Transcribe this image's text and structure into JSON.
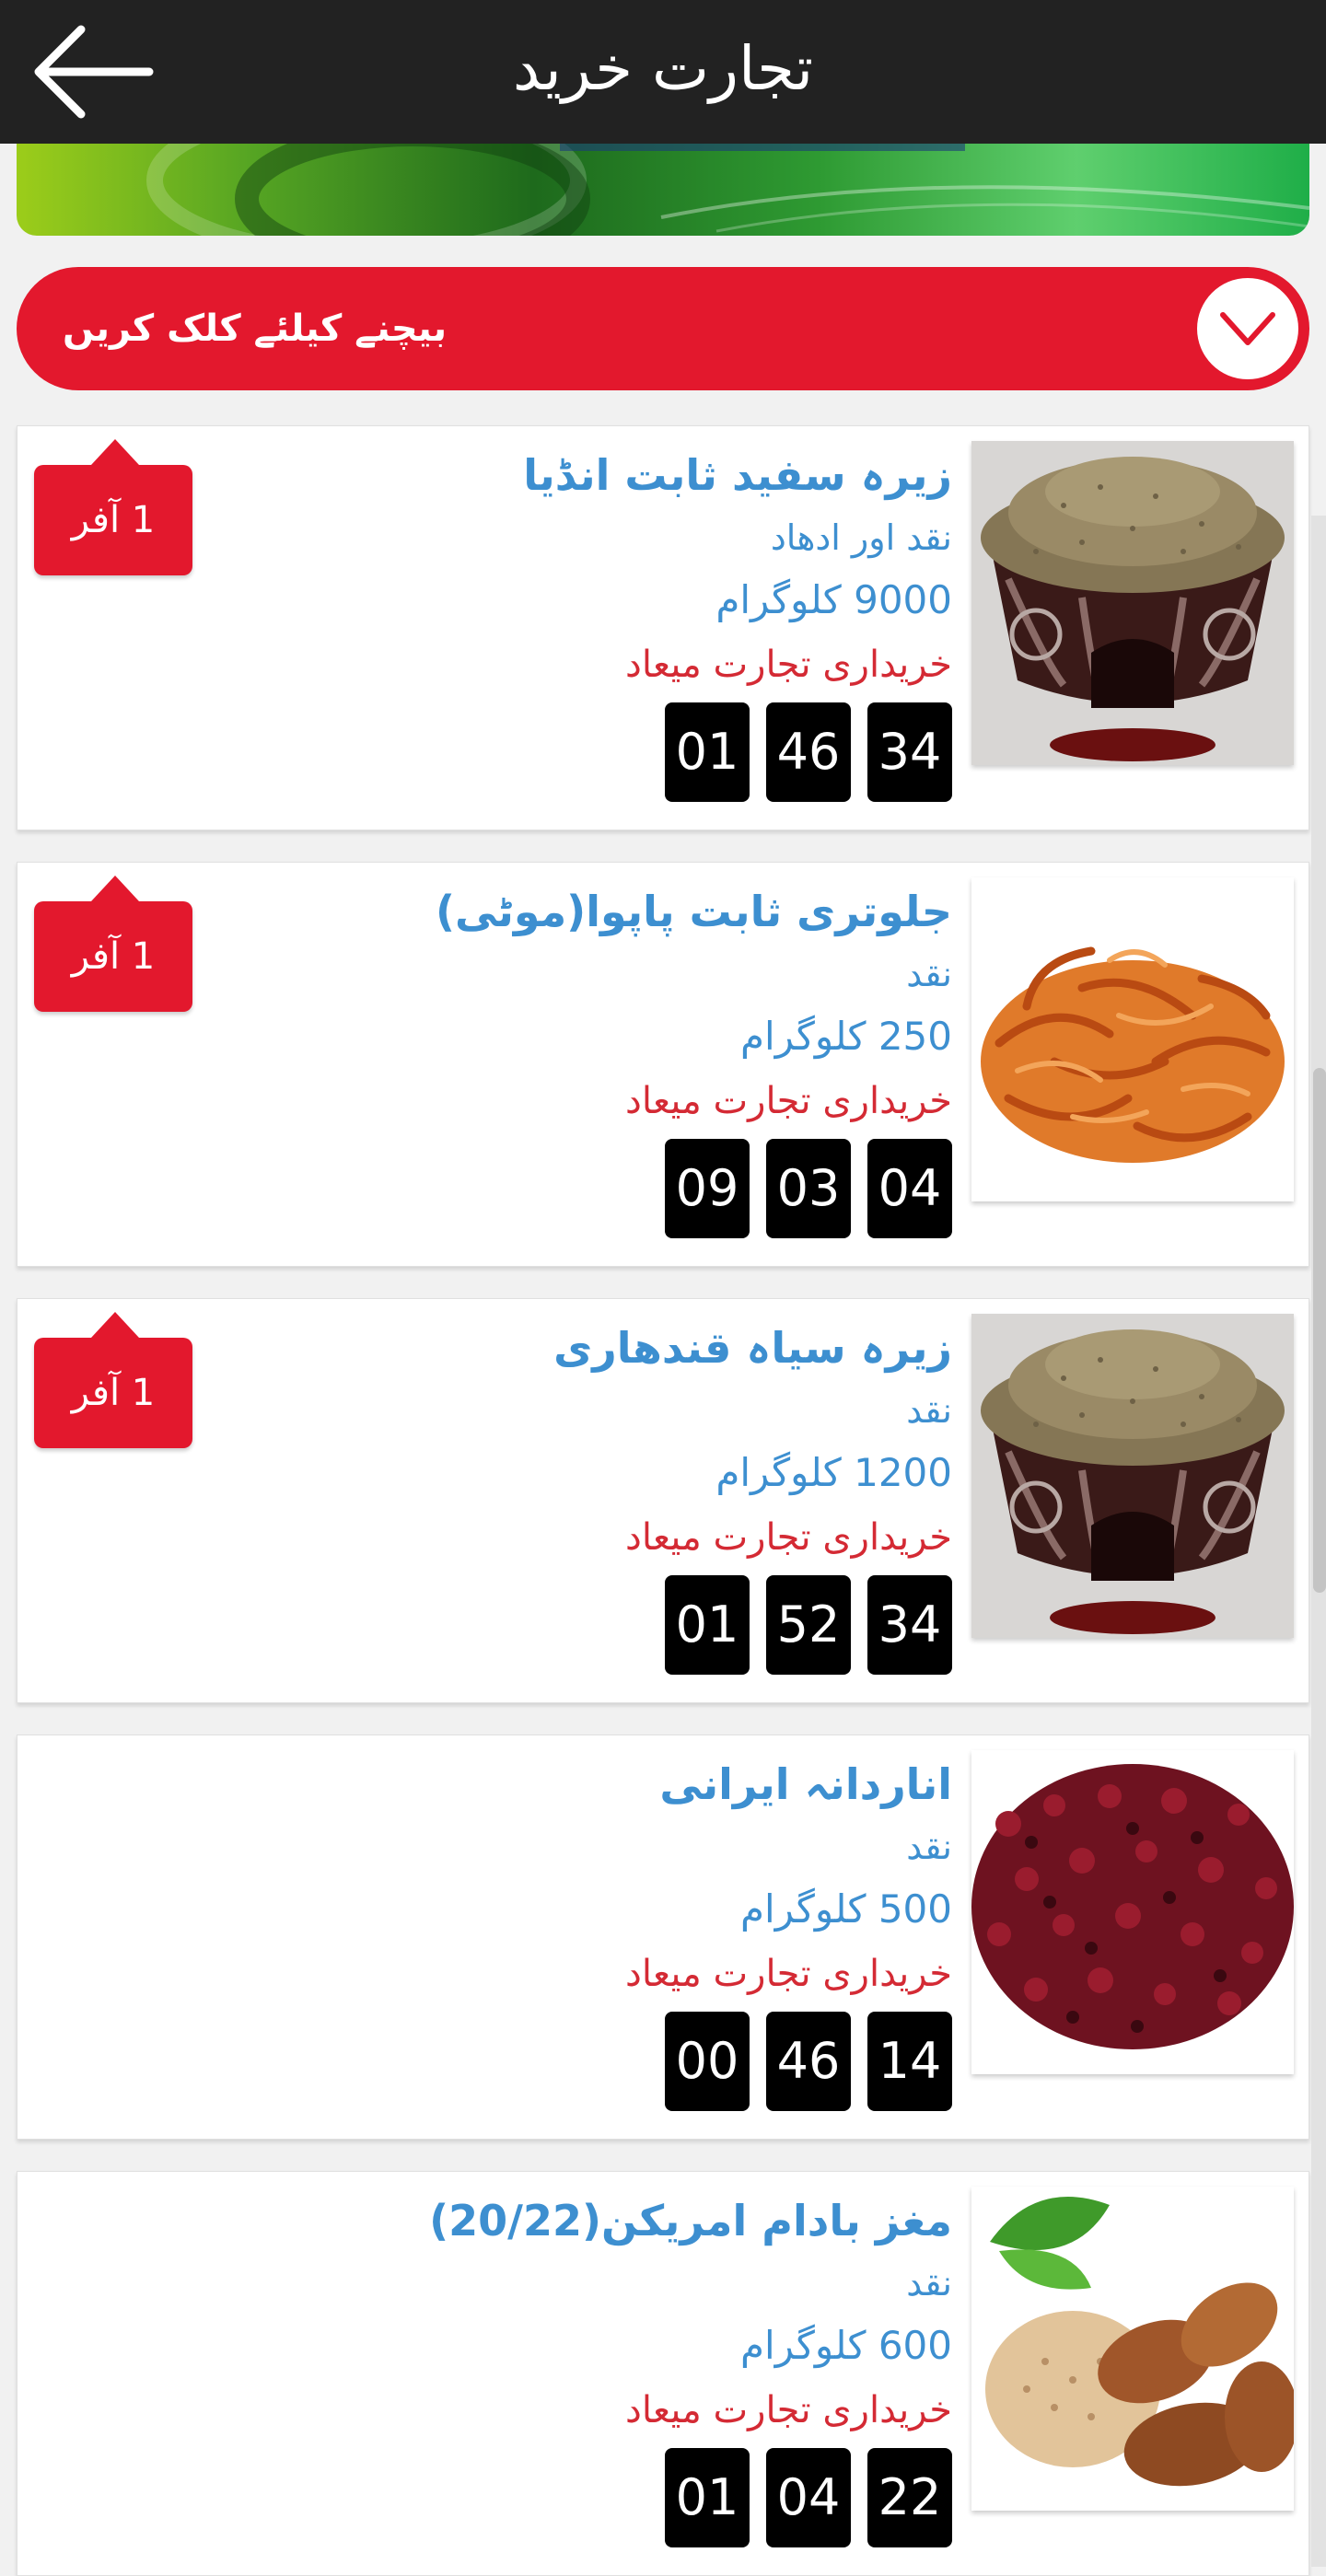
{
  "header": {
    "title": "تجارت خرید",
    "back_icon": "arrow-left-icon"
  },
  "sell_bar": {
    "label": "بیچنے کیلئے کلک کریں",
    "toggle_icon": "chevron-down-icon"
  },
  "colors": {
    "accent_red": "#e3182d",
    "link_blue": "#3d8fd0",
    "deadline_red": "#d42a34",
    "header_bg": "#222222"
  },
  "products": [
    {
      "name": "زیرہ سفید ثابت انڈیا",
      "payment": "نقد اور ادھاد",
      "quantity": "9000 کلوگرام",
      "deadline_label": "خریداری تجارت میعاد",
      "timer": [
        "01",
        "46",
        "34"
      ],
      "offer": "1 آفر",
      "image": "cumin-bowl"
    },
    {
      "name": "جلوتری ثابت پاپوا(موٹی)",
      "payment": "نقد",
      "quantity": "250 کلوگرام",
      "deadline_label": "خریداری تجارت میعاد",
      "timer": [
        "09",
        "03",
        "04"
      ],
      "offer": "1 آفر",
      "image": "mace-pile"
    },
    {
      "name": "زیرہ سیاہ قندھاری",
      "payment": "نقد",
      "quantity": "1200 کلوگرام",
      "deadline_label": "خریداری تجارت میعاد",
      "timer": [
        "01",
        "52",
        "34"
      ],
      "offer": "1 آفر",
      "image": "cumin-bowl"
    },
    {
      "name": "اناردانہ ایرانی",
      "payment": "نقد",
      "quantity": "500 کلوگرام",
      "deadline_label": "خریداری تجارت میعاد",
      "timer": [
        "00",
        "46",
        "14"
      ],
      "offer": null,
      "image": "pomegranate-seeds"
    },
    {
      "name": "مغز بادام امریکن(20/22)",
      "payment": "نقد",
      "quantity": "600 کلوگرام",
      "deadline_label": "خریداری تجارت میعاد",
      "timer": [
        "01",
        "04",
        "22"
      ],
      "offer": null,
      "image": "almonds"
    }
  ]
}
